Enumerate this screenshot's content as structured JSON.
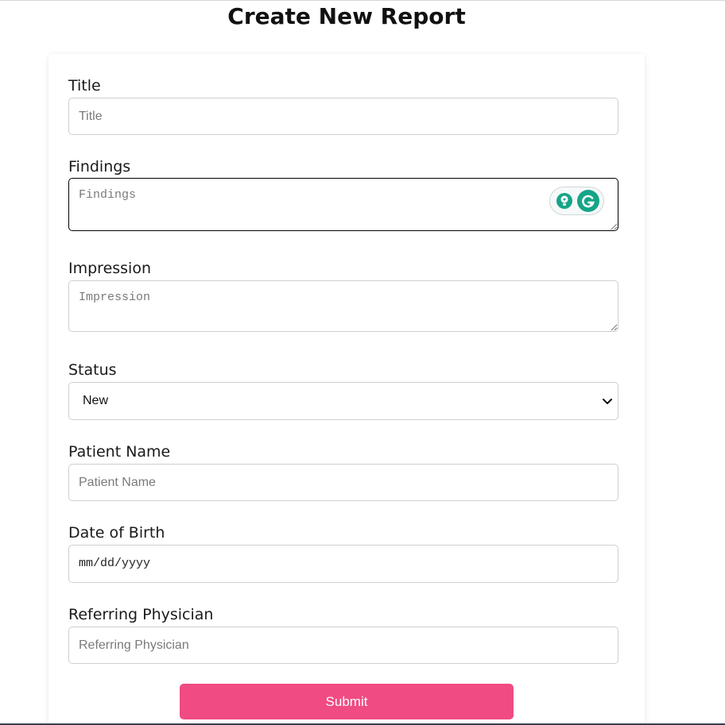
{
  "page": {
    "title": "Create New Report"
  },
  "form": {
    "title": {
      "label": "Title",
      "placeholder": "Title"
    },
    "findings": {
      "label": "Findings",
      "placeholder": "Findings"
    },
    "impression": {
      "label": "Impression",
      "placeholder": "Impression"
    },
    "status": {
      "label": "Status",
      "value": "New"
    },
    "patient_name": {
      "label": "Patient Name",
      "placeholder": "Patient Name"
    },
    "date_of_birth": {
      "label": "Date of Birth",
      "value": "mm/dd/yyyy"
    },
    "referring_physician": {
      "label": "Referring Physician",
      "placeholder": "Referring Physician"
    },
    "submit_label": "Submit"
  },
  "icons": {
    "grammarly_bulb": "lightbulb-icon",
    "grammarly_logo": "grammarly-g-icon",
    "select_chevron": "chevron-down-icon"
  },
  "colors": {
    "accent": "#f04b82",
    "grammarly": "#15a588"
  }
}
